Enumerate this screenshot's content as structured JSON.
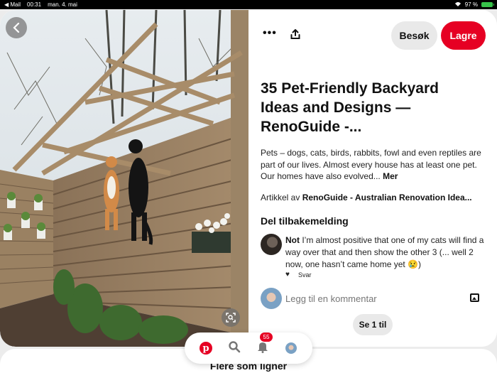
{
  "status_bar": {
    "back_app": "◀ Mail",
    "time": "00:31",
    "date": "man. 4. mai",
    "battery": "97 %"
  },
  "pin": {
    "title": "35 Pet-Friendly Backyard Ideas and Designs — RenoGuide -...",
    "description": "Pets – dogs, cats, birds, rabbits, fowl and even reptiles are part of our lives. Almost every house has at least one pet. Our homes have also evolved...",
    "description_more": "Mer",
    "source_prefix": "Artikkel av",
    "source_name": "RenoGuide - Australian Renovation Idea..."
  },
  "actions": {
    "visit_label": "Besøk",
    "save_label": "Lagre"
  },
  "feedback": {
    "heading": "Del tilbakemelding",
    "comment": {
      "author": "Not",
      "text": " I’m almost positive that one of my cats will find a way over that and then show the other 3 (... well 2 now, one hasn’t came home yet 😢)",
      "reply_label": "Svar"
    },
    "add_comment_placeholder": "Legg til en kommentar",
    "see_more_label": "Se 1 til"
  },
  "more_like_this": "Flere som ligner",
  "nav": {
    "notifications_count": "55"
  },
  "colors": {
    "brand_red": "#e60023",
    "pill_gray": "#e9e9e9"
  },
  "icons": [
    "back-icon",
    "more-icon",
    "share-icon",
    "visual-search-icon",
    "heart-icon",
    "image-icon",
    "pinterest-logo-icon",
    "search-icon",
    "bell-icon",
    "profile-avatar"
  ]
}
